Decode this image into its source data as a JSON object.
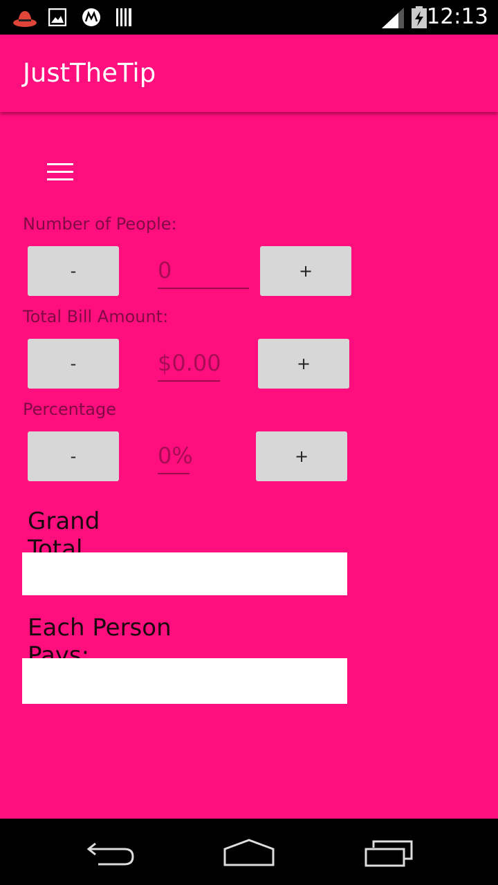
{
  "status_bar": {
    "time": "12:13",
    "icons": [
      "redhat-icon",
      "image-icon",
      "motorola-icon",
      "barcode-icon",
      "signal-icon",
      "battery-charging-icon"
    ]
  },
  "app_bar": {
    "title": "JustTheTip"
  },
  "form": {
    "people": {
      "label": "Number of People:",
      "minus": "-",
      "value": "0",
      "plus": "+"
    },
    "bill": {
      "label": "Total Bill Amount:",
      "minus": "-",
      "value": "$0.00",
      "plus": "+"
    },
    "percentage": {
      "label": "Percentage",
      "minus": "-",
      "value": "0%",
      "plus": "+"
    }
  },
  "results": {
    "grand_total_label": "Grand Total",
    "grand_total_value": "",
    "each_person_label": "Each Person Pays:",
    "each_person_value": ""
  },
  "nav_bar": {
    "buttons": [
      "back-icon",
      "home-icon",
      "recents-icon"
    ]
  },
  "colors": {
    "accent": "#ff0f7e",
    "button": "#d7d7d7"
  }
}
